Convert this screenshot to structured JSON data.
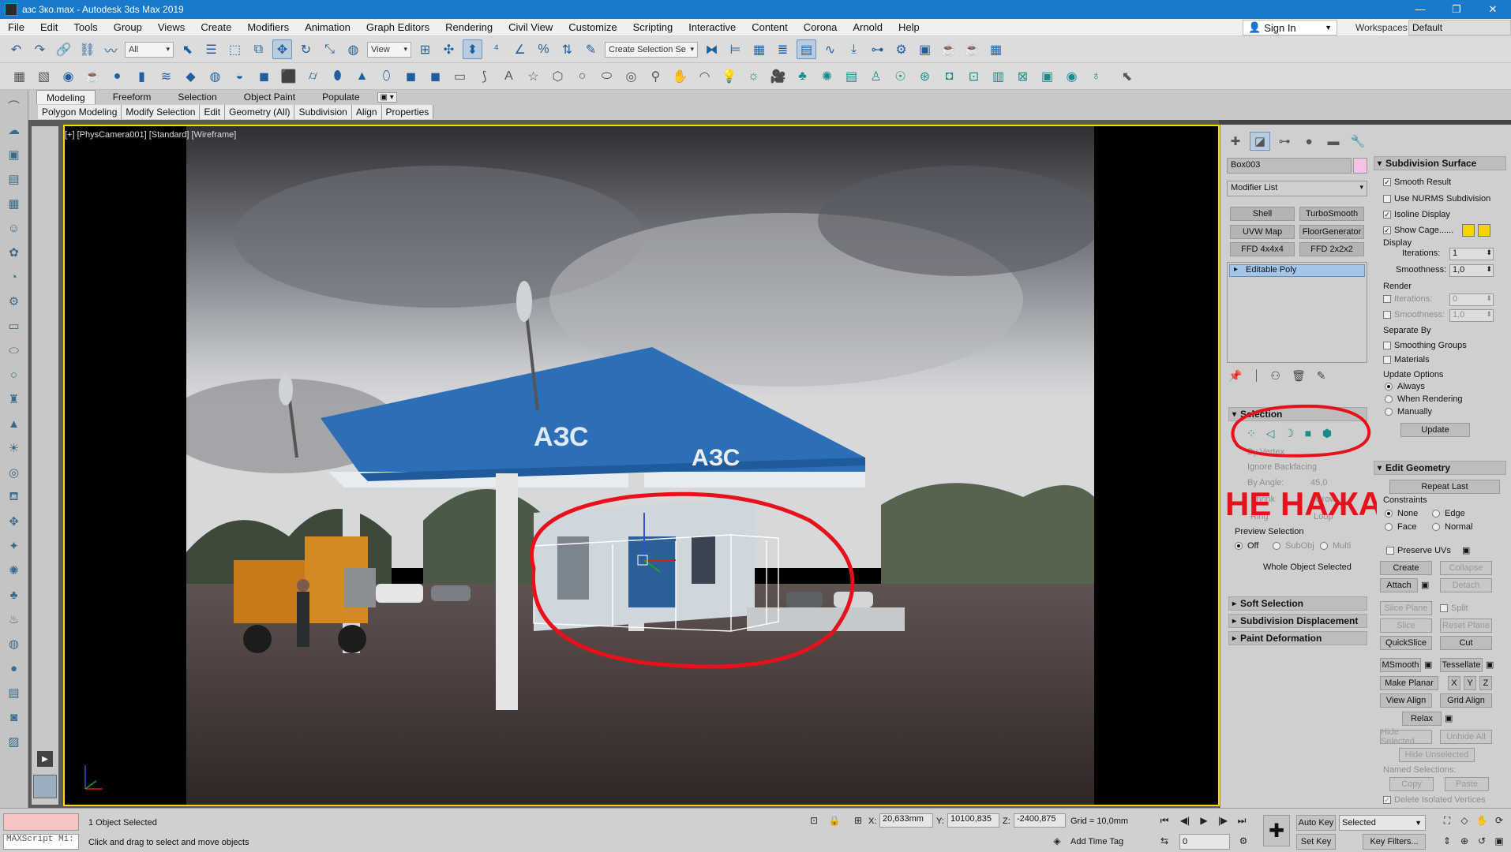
{
  "window": {
    "title": "азс 3ко.max - Autodesk 3ds Max 2019",
    "min": "—",
    "max": "❐",
    "close": "✕"
  },
  "menu": [
    "File",
    "Edit",
    "Tools",
    "Group",
    "Views",
    "Create",
    "Modifiers",
    "Animation",
    "Graph Editors",
    "Rendering",
    "Civil View",
    "Customize",
    "Scripting",
    "Interactive",
    "Content",
    "Corona",
    "Arnold",
    "Help"
  ],
  "signin": "Sign In",
  "workspaces": {
    "label": "Workspaces:",
    "value": "Default"
  },
  "toolbar": {
    "filter": "All",
    "refcoord": "View",
    "named_sel": "Create Selection Se"
  },
  "ribbon": {
    "tabs": [
      "Modeling",
      "Freeform",
      "Selection",
      "Object Paint",
      "Populate"
    ],
    "option": "▣ ▾",
    "subtabs": [
      "Polygon Modeling",
      "Modify Selection",
      "Edit",
      "Geometry (All)",
      "Subdivision",
      "Align",
      "Properties"
    ]
  },
  "viewport": {
    "label": "[+] [PhysCamera001] [Standard] [Wireframe]",
    "sign1": "АЗС",
    "sign2": "АЗС",
    "annotation": "НЕ НАЖАТО"
  },
  "command_panel": {
    "object_name": "Box003",
    "modifier_list": "Modifier List",
    "modifier_buttons": [
      "Shell",
      "TurboSmooth",
      "UVW Map",
      "FloorGenerator",
      "FFD 4x4x4",
      "FFD 2x2x2"
    ],
    "stack_item": "Editable Poly",
    "selection": {
      "title": "Selection",
      "by_vertex": "By Vertex",
      "ignore_backfacing": "Ignore Backfacing",
      "by_angle": "By Angle:",
      "angle_value": "45,0",
      "shrink": "Shrink",
      "grow": "Grow",
      "ring": "Ring",
      "loop": "Loop",
      "preview_label": "Preview Selection",
      "preview_off": "Off",
      "preview_subobj": "SubObj",
      "preview_multi": "Multi",
      "status": "Whole Object Selected"
    },
    "rollouts": [
      "Soft Selection",
      "Subdivision Displacement",
      "Paint Deformation"
    ]
  },
  "subdivision_surface": {
    "title": "Subdivision Surface",
    "smooth_result": "Smooth Result",
    "use_nurms": "Use NURMS Subdivision",
    "isoline": "Isoline Display",
    "show_cage": "Show Cage......",
    "display_label": "Display",
    "iterations_label": "Iterations:",
    "iterations": "1",
    "smoothness_label": "Smoothness:",
    "smoothness": "1,0",
    "render_label": "Render",
    "render_iterations": "0",
    "render_smoothness": "1,0",
    "separate_label": "Separate By",
    "smoothing_groups": "Smoothing Groups",
    "materials": "Materials",
    "update_label": "Update Options",
    "always": "Always",
    "when_rendering": "When Rendering",
    "manually": "Manually",
    "update_btn": "Update"
  },
  "edit_geometry": {
    "title": "Edit Geometry",
    "repeat_last": "Repeat Last",
    "constraints": "Constraints",
    "none": "None",
    "edge": "Edge",
    "face": "Face",
    "normal": "Normal",
    "preserve_uvs": "Preserve UVs",
    "create": "Create",
    "collapse": "Collapse",
    "attach": "Attach",
    "detach": "Detach",
    "slice_plane": "Slice Plane",
    "split": "Split",
    "slice": "Slice",
    "reset_plane": "Reset Plane",
    "quickslice": "QuickSlice",
    "cut": "Cut",
    "msmooth": "MSmooth",
    "tessellate": "Tessellate",
    "make_planar": "Make Planar",
    "x": "X",
    "y": "Y",
    "z": "Z",
    "view_align": "View Align",
    "grid_align": "Grid Align",
    "relax": "Relax",
    "hide_selected": "Hide Selected",
    "unhide_all": "Unhide All",
    "hide_unselected": "Hide Unselected",
    "named_selections": "Named Selections:",
    "copy": "Copy",
    "paste": "Paste",
    "delete_isolated": "Delete Isolated Vertices"
  },
  "status": {
    "maxscript": "MAXScript Mi:",
    "selected": "1 Object Selected",
    "prompt": "Click and drag to select and move objects",
    "x_label": "X:",
    "x": "20,633mm",
    "y_label": "Y:",
    "y": "10100,835",
    "z_label": "Z:",
    "z": "-2400,875",
    "grid": "Grid = 10,0mm",
    "add_time_tag": "Add Time Tag",
    "auto_key": "Auto Key",
    "set_key": "Set Key",
    "selected_dd": "Selected",
    "key_filters": "Key Filters...",
    "frame": "0"
  },
  "colors": {
    "title_bar": "#1979ca",
    "viewport_border": "#ffd800",
    "annotation": "#e8101a",
    "stack_highlight": "#a3c5e8"
  }
}
